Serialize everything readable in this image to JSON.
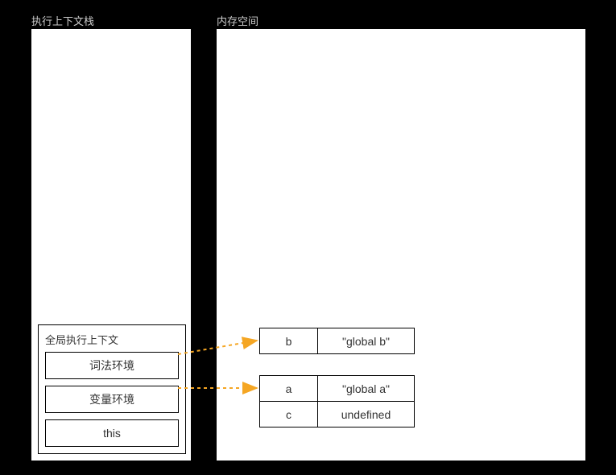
{
  "titles": {
    "left": "执行上下文栈",
    "right": "内存空间"
  },
  "context": {
    "title": "全局执行上下文",
    "lexical": "词法环境",
    "variable": "变量环境",
    "thisbind": "this"
  },
  "memory": {
    "table1": {
      "rows": [
        {
          "key": "b",
          "val": "\"global b\""
        }
      ]
    },
    "table2": {
      "rows": [
        {
          "key": "a",
          "val": "\"global a\""
        },
        {
          "key": "c",
          "val": "undefined"
        }
      ]
    }
  }
}
